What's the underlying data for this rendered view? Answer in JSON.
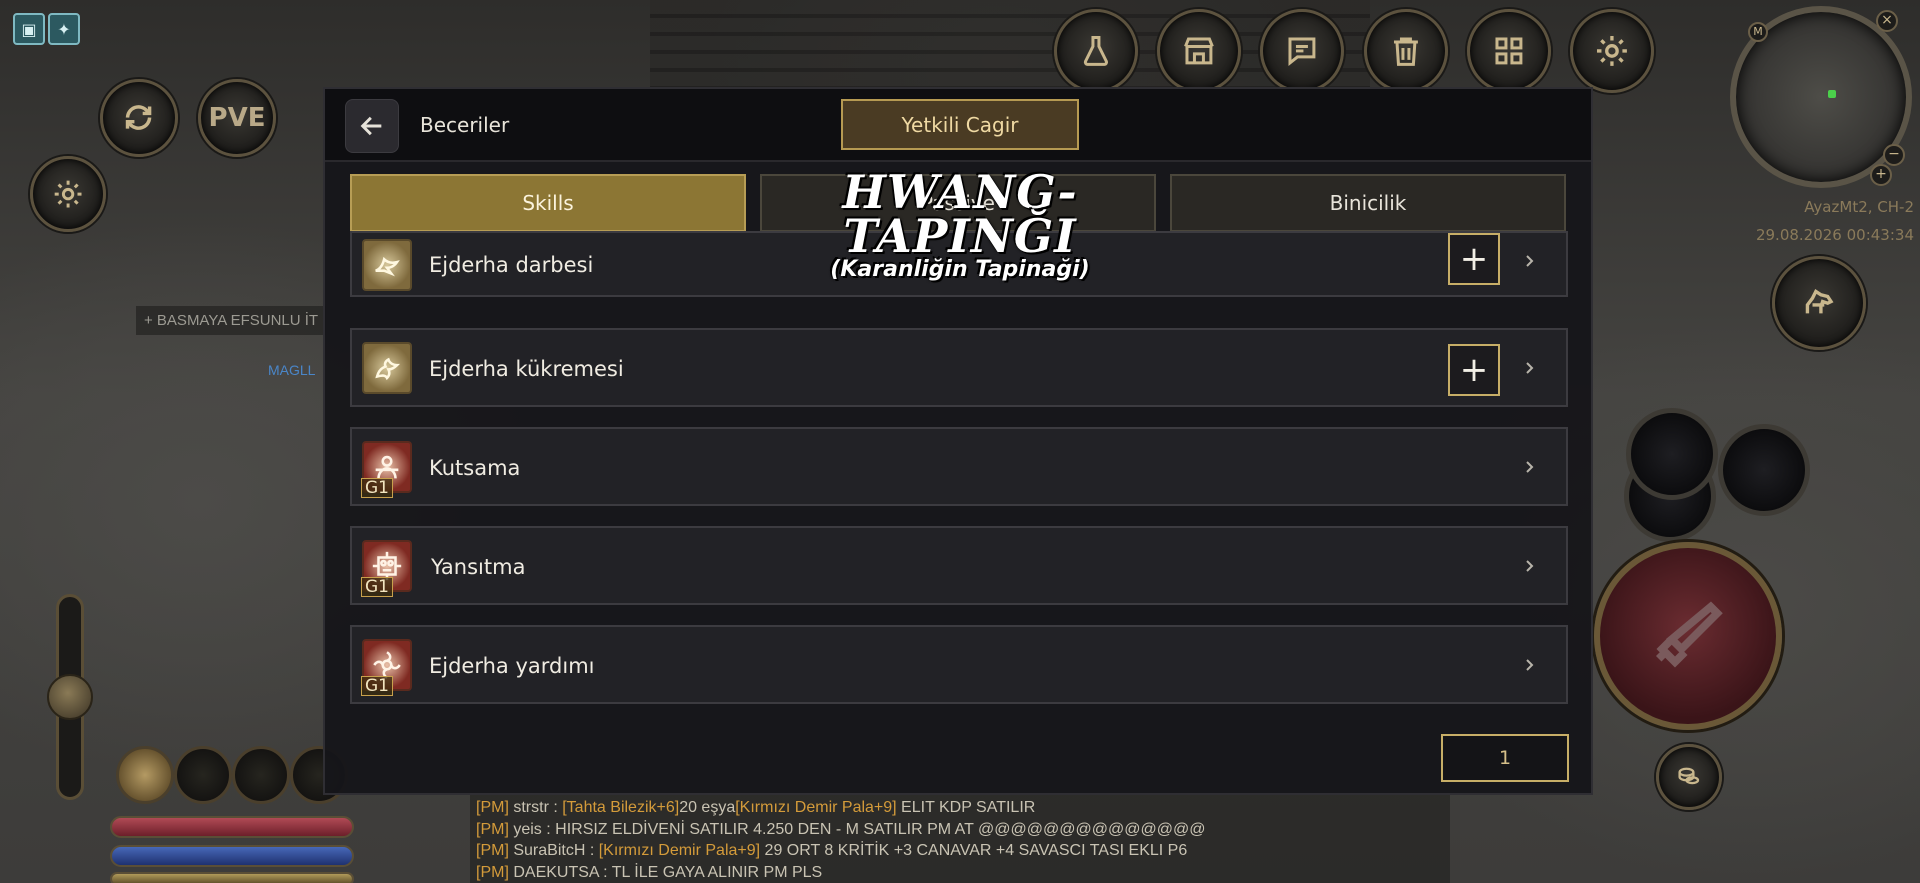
{
  "hud": {
    "pve_label": "PVE",
    "side_notice": "+ BASMAYA EFSUNLU İT",
    "side_name": "MAGLL",
    "map_name": "AyazMt2, CH-2",
    "datetime": "29.08.2026 00:43:34",
    "minimap_marker": "M"
  },
  "panel": {
    "title": "Beceriler",
    "gm_button": "Yetkili Cagir",
    "tabs": [
      {
        "label": "Skills",
        "active": true
      },
      {
        "label": "Passive",
        "active": false
      },
      {
        "label": "Binicilik",
        "active": false
      }
    ],
    "skills": [
      {
        "name": "Ejderha darbesi",
        "grade": "",
        "icon": "dragon-strike-icon",
        "can_upgrade": true,
        "plus": "+"
      },
      {
        "name": "Ejderha kükremesi",
        "grade": "",
        "icon": "dragon-roar-icon",
        "can_upgrade": true,
        "plus": "+"
      },
      {
        "name": "Kutsama",
        "grade": "G1",
        "icon": "blessing-icon",
        "can_upgrade": false,
        "plus": ""
      },
      {
        "name": "Yansıtma",
        "grade": "G1",
        "icon": "reflect-icon",
        "can_upgrade": false,
        "plus": ""
      },
      {
        "name": "Ejderha yardımı",
        "grade": "G1",
        "icon": "dragon-aid-icon",
        "can_upgrade": false,
        "plus": ""
      }
    ],
    "page": "1"
  },
  "watermark": {
    "main": "HWANG-TAPINĞI",
    "sub": "(Karanliğin Tapinaği)"
  },
  "chat": [
    {
      "tag": "[PM]",
      "sender": "strstr :",
      "item1": "[Tahta Bilezik+6]",
      "mid": "20 eşya",
      "item2": "[Kırmızı Demir Pala+9]",
      "rest": " ELIT KDP SATILIR"
    },
    {
      "tag": "[PM]",
      "sender": "yeis :",
      "item1": "",
      "mid": " HIRSIZ ELDİVENİ SATILIR 4.250 DEN - M SATILIR PM AT",
      "item2": "",
      "rest": " @@@@@@@@@@@@@@"
    },
    {
      "tag": "[PM]",
      "sender": "SuraBitcH :",
      "item1": " [Kırmızı Demir Pala+9]",
      "mid": " 29 ORT 8 KRİTİK +3 CANAVAR +4 SAVASCI TASI EKLI P6",
      "item2": "",
      "rest": ""
    },
    {
      "tag": "[PM]",
      "sender": "DAEKUTSA :",
      "item1": "",
      "mid": " TL İLE GAYA ALINIR PM PLS",
      "item2": "",
      "rest": ""
    }
  ],
  "colors": {
    "accent_gold": "#b69a52",
    "active_tab": "#8c7634",
    "panel_bg": "#16161a",
    "chat_tag": "#d49b3a"
  }
}
